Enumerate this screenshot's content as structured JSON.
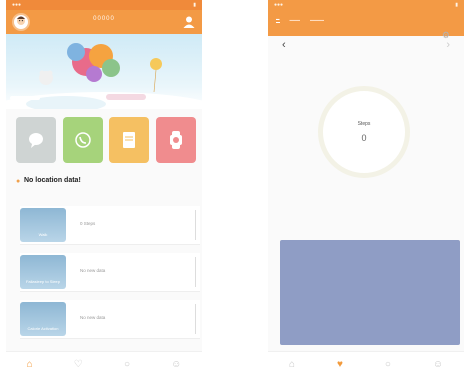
{
  "left_screen": {
    "header": {
      "title": "00000",
      "avatar_icon": "child-avatar",
      "user_icon": "person-icon"
    },
    "quick_actions": [
      {
        "name": "chat",
        "icon": "chat-bubble-icon",
        "color": "#cfd4d3"
      },
      {
        "name": "call",
        "icon": "phone-icon",
        "color": "#a6d37b"
      },
      {
        "name": "notes",
        "icon": "note-icon",
        "color": "#f5c062"
      },
      {
        "name": "watch",
        "icon": "watch-icon",
        "color": "#f08c8e"
      }
    ],
    "location": {
      "title": "No location data!"
    },
    "cards": [
      {
        "thumb_label": "Walk",
        "value": "0 Steps"
      },
      {
        "thumb_label": "Fallasleep to Sleep",
        "value": "No new data"
      },
      {
        "thumb_label": "Calorie Activation",
        "value": "No new data"
      }
    ],
    "nav": [
      {
        "name": "home",
        "active": true
      },
      {
        "name": "health",
        "active": false
      },
      {
        "name": "find",
        "active": false
      },
      {
        "name": "me",
        "active": false
      }
    ]
  },
  "right_screen": {
    "steps": {
      "label": "Steps",
      "value": "0"
    },
    "nav": [
      {
        "name": "home",
        "active": false
      },
      {
        "name": "health",
        "active": true
      },
      {
        "name": "find",
        "active": false
      },
      {
        "name": "me",
        "active": false
      }
    ]
  },
  "colors": {
    "accent": "#f39a45",
    "chart_bg": "#8f9dc5"
  }
}
